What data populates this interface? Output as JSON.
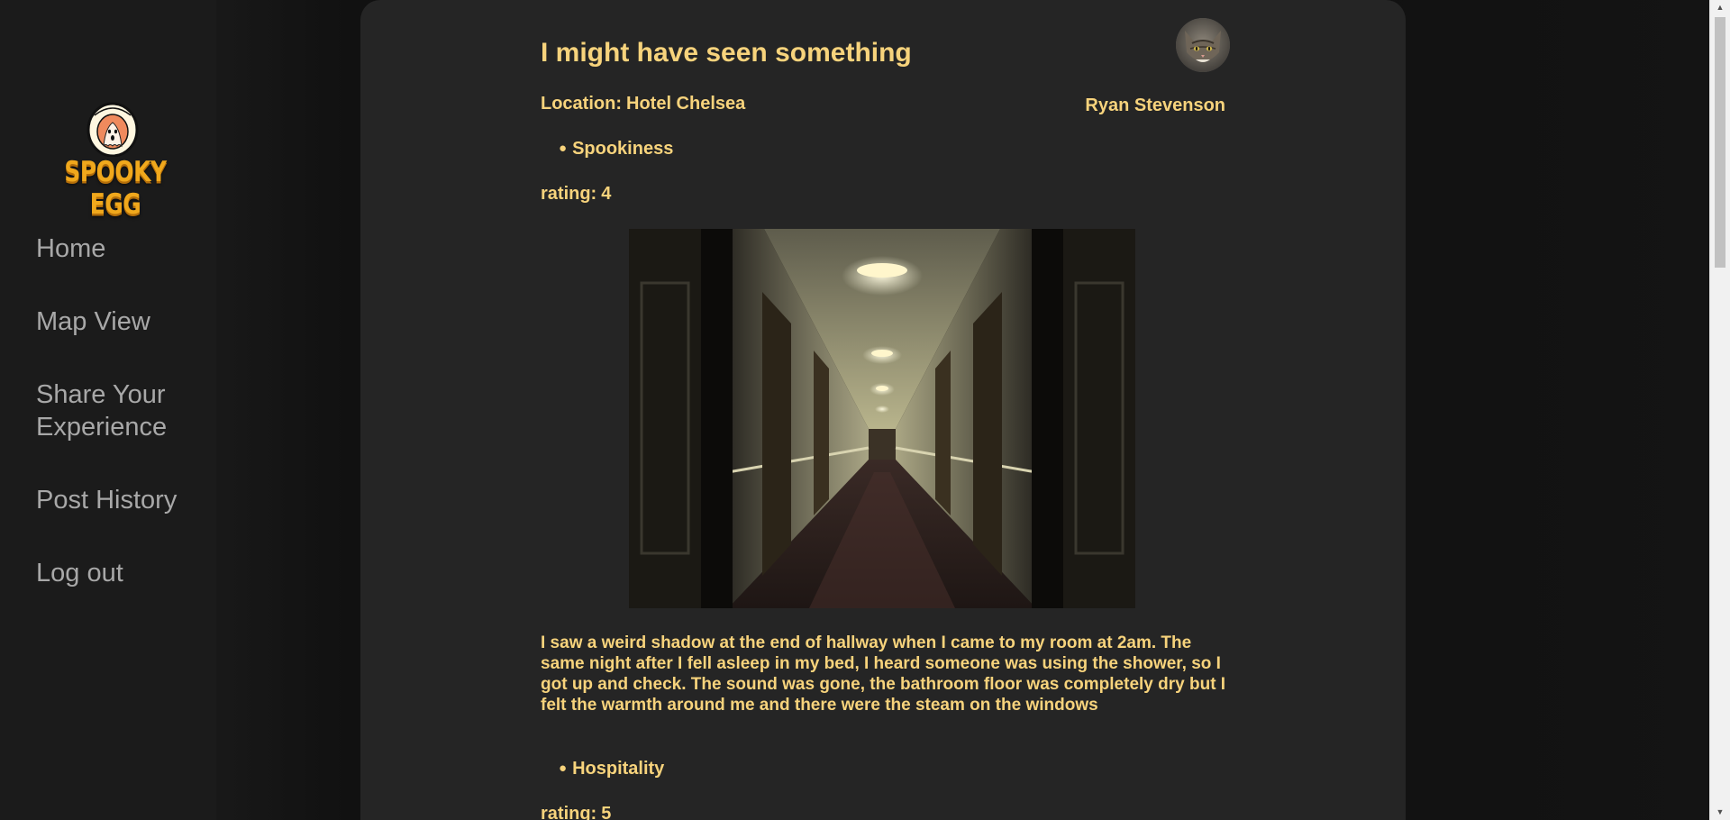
{
  "brand": {
    "logo_text": "SPOOKY EGG",
    "accent_color": "#f0a81c",
    "text_color": "#f7d37c"
  },
  "sidebar": {
    "items": [
      {
        "label": "Home"
      },
      {
        "label": "Map View"
      },
      {
        "label": "Share Your Experience"
      },
      {
        "label": "Post History"
      },
      {
        "label": "Log out"
      }
    ]
  },
  "post": {
    "title": "I might have seen something",
    "author": "Ryan Stevenson",
    "location_label": "Location:",
    "location_value": "Hotel Chelsea",
    "categories": [
      {
        "name": "Spookiness",
        "rating_label": "rating:",
        "rating_value": "4"
      },
      {
        "name": "Hospitality",
        "rating_label": "rating:",
        "rating_value": "5"
      }
    ],
    "description": "I saw a weird shadow at the end of hallway when I came to my room at 2am. The same night after I fell asleep in my bed, I heard someone was using the shower, so I got up and check. The sound was gone, the bathroom floor was completely dry but I felt the warmth around me and there were the steam on the windows",
    "avatar_icon": "cat-avatar",
    "photo_subject": "hotel-hallway-photo"
  }
}
